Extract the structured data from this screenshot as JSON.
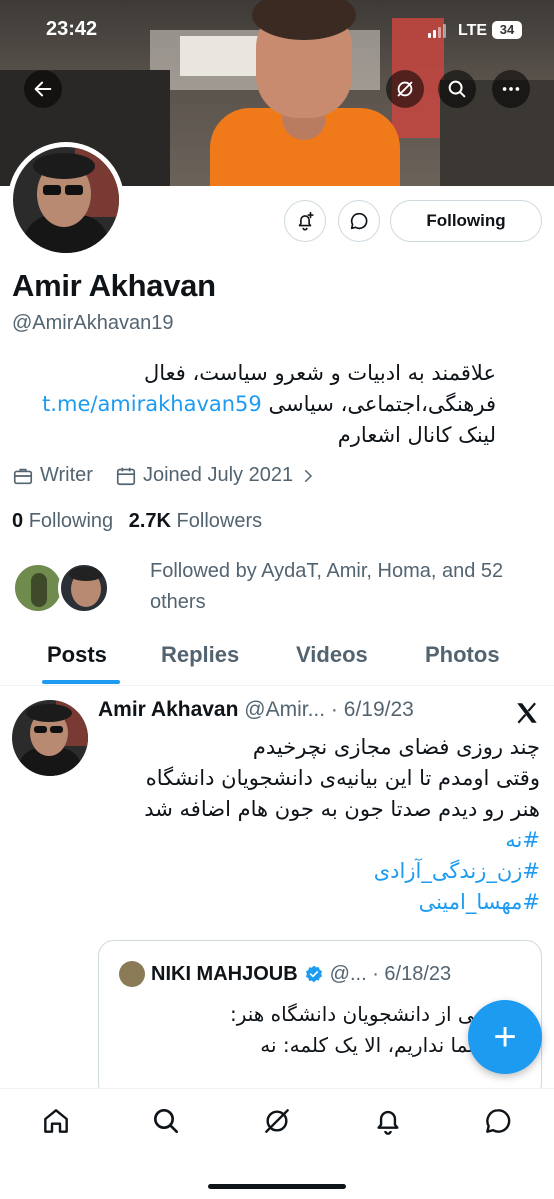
{
  "status_bar": {
    "time": "23:42",
    "network": "LTE",
    "battery": "34"
  },
  "profile": {
    "name": "Amir Akhavan",
    "handle": "@AmirAkhavan19",
    "bio_lines": [
      "علاقمند به ادبیات و شعرو سیاست، فعال",
      "فرهنگی،اجتماعی، سیاسی",
      "لینک کانال اشعارم"
    ],
    "bio_link": "t.me/amirakhavan59",
    "occupation": "Writer",
    "joined": "Joined July 2021",
    "following_count": "0",
    "following_label": "Following",
    "followers_count": "2.7K",
    "followers_label": "Followers",
    "followed_by": "Followed by AydaT, Amir, Homa, and 52 others"
  },
  "actions": {
    "follow_label": "Following"
  },
  "tabs": [
    {
      "label": "Posts",
      "active": true
    },
    {
      "label": "Replies"
    },
    {
      "label": "Videos"
    },
    {
      "label": "Photos"
    }
  ],
  "post": {
    "author": "Amir Akhavan",
    "handle_date": "@Amir... · 6/19/23",
    "lines": [
      "چند روزی فضای مجازی نچرخیدم",
      "وقتی اومدم تا این بیانیه‌ی دانشجویان دانشگاه",
      "هنر رو دیدم صدتا جون به جون هام اضافه شد"
    ],
    "hashtags": [
      "#نه",
      "#زن_زندگی_آزادی",
      "#مهسا_امینی"
    ],
    "quote": {
      "author": "NIKI MAHJOUB",
      "handle_date": "@... · 6/18/23",
      "lines": [
        "ه جمعی از دانشجویان دانشگاه هنر:",
        "ی با شما نداریم، الا یک کلمه: نه"
      ]
    }
  },
  "icons": {
    "back": "back-arrow-icon",
    "grok": "grok-icon",
    "search": "search-icon",
    "more": "more-icon",
    "notify": "notification-add-icon",
    "message": "message-icon",
    "briefcase": "briefcase-icon",
    "calendar": "calendar-icon",
    "compose": "plus-icon"
  },
  "colors": {
    "accent": "#1d9bf0",
    "text": "#0f1419",
    "muted": "#536471",
    "border": "#cfd9de"
  }
}
